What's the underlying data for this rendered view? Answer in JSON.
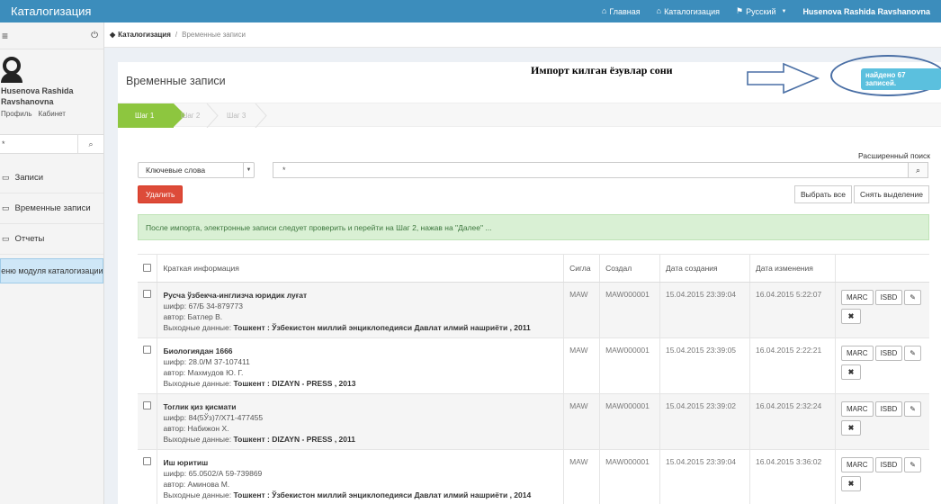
{
  "topbar": {
    "brand": "Каталогизация",
    "nav": [
      {
        "icon": "bank-icon",
        "glyph": "⌂",
        "label": "Главная"
      },
      {
        "icon": "bank-icon",
        "glyph": "⌂",
        "label": "Каталогизация"
      },
      {
        "icon": "flag-icon",
        "glyph": "⚑",
        "label": "Русский"
      }
    ],
    "user": "Husenova Rashida Ravshanovna"
  },
  "sidebar": {
    "user_name": "Husenova Rashida Ravshanovna",
    "profile_link": "Профиль",
    "cabinet_link": "Кабинет",
    "search_value": "*",
    "items": [
      {
        "label": "Записи"
      },
      {
        "label": "Временные записи"
      },
      {
        "label": "Отчеты"
      }
    ],
    "active_item": "меню модуля каталогизации"
  },
  "breadcrumb": {
    "home": "Каталогизация",
    "current": "Временные записи"
  },
  "panel": {
    "title": "Временные записи",
    "annotation": "Импорт килган ёзувлар сони",
    "found_badge": "найдено 67 записей.",
    "steps": [
      "Шаг 1",
      "Шаг 2",
      "Шаг 3"
    ],
    "advanced_search": "Расширенный поиск",
    "search_field_select": "Ключевые слова",
    "search_value": "*",
    "delete_label": "Удалить",
    "select_all_label": "Выбрать все",
    "deselect_label": "Снять выделение",
    "alert": "После импорта, электронные записи следует проверить и перейти на Шаг 2, нажав на \"Далее\" ..."
  },
  "table": {
    "headers": {
      "info": "Краткая информация",
      "sigla": "Сигла",
      "creator": "Создал",
      "created": "Дата создания",
      "modified": "Дата изменения"
    },
    "labels": {
      "cipher": "шифр:",
      "author": "автор:",
      "output": "Выходные данные:"
    },
    "buttons": {
      "marc": "MARC",
      "isbd": "ISBD"
    },
    "rows": [
      {
        "title": "Русча ўзбекча-инглизча юридик луғат",
        "cipher": "67/Б 34-879773",
        "author": "Батлер В.",
        "output": "Тошкент : Ўзбекистон миллий энциклопедияси Давлат илмий нашриёти , 2011",
        "sigla": "MAW",
        "creator": "MAW000001",
        "created": "15.04.2015 23:39:04",
        "modified": "16.04.2015 5:22:07"
      },
      {
        "title": "Биологиядан 1666",
        "cipher": "28.0/М 37-107411",
        "author": "Махмудов Ю. Г.",
        "output": "Тошкент : DIZAYN - PRESS , 2013",
        "sigla": "MAW",
        "creator": "MAW000001",
        "created": "15.04.2015 23:39:05",
        "modified": "16.04.2015 2:22:21"
      },
      {
        "title": "Тоглик қиз қисмати",
        "cipher": "84(5Ўз)7/Х71-477455",
        "author": "Набижон Х.",
        "output": "Тошкент : DIZAYN - PRESS , 2011",
        "sigla": "MAW",
        "creator": "MAW000001",
        "created": "15.04.2015 23:39:02",
        "modified": "16.04.2015 2:32:24"
      },
      {
        "title": "Иш юритиш",
        "cipher": "65.0502/А 59-739869",
        "author": "Аминова М.",
        "output": "Тошкент : Ўзбекистон миллий энциклопедияси Давлат илмий нашриёти , 2014",
        "sigla": "MAW",
        "creator": "MAW000001",
        "created": "15.04.2015 23:39:04",
        "modified": "16.04.2015 3:36:02"
      }
    ]
  }
}
